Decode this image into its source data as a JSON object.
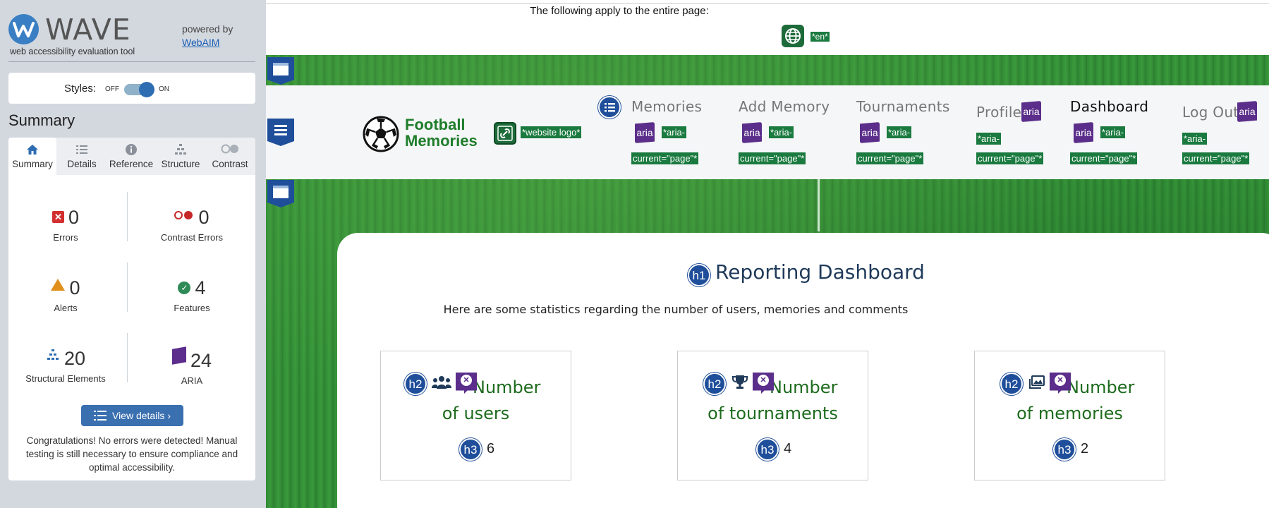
{
  "wave": {
    "title": "WAVE",
    "tagline": "web accessibility evaluation tool",
    "powered_by": "powered by",
    "webaim_link": "WebAIM",
    "styles_label": "Styles:",
    "styles_off": "OFF",
    "styles_on": "ON",
    "summary_heading": "Summary",
    "tabs": [
      {
        "label": "Summary",
        "icon": "home-icon"
      },
      {
        "label": "Details",
        "icon": "list-icon"
      },
      {
        "label": "Reference",
        "icon": "info-icon"
      },
      {
        "label": "Structure",
        "icon": "sitemap-icon"
      },
      {
        "label": "Contrast",
        "icon": "contrast-icon"
      }
    ],
    "stats": {
      "errors": {
        "value": "0",
        "label": "Errors"
      },
      "contrast_errors": {
        "value": "0",
        "label": "Contrast Errors"
      },
      "alerts": {
        "value": "0",
        "label": "Alerts"
      },
      "features": {
        "value": "4",
        "label": "Features"
      },
      "structural": {
        "value": "20",
        "label": "Structural Elements"
      },
      "aria": {
        "value": "24",
        "label": "ARIA"
      }
    },
    "view_details": "View details ›",
    "congrats": "Congratulations! No errors were detected! Manual testing is still necessary to ensure compliance and optimal accessibility."
  },
  "page": {
    "entire_page_note": "The following apply to the entire page:",
    "lang_tag": "*en*",
    "site_name_line1": "Football",
    "site_name_line2": "Memories",
    "logo_tag": "*website logo*",
    "aria_label": "aria",
    "aria_current_line1": "*aria-",
    "aria_current_line2": "current=\"page\"*",
    "nav": [
      {
        "label": "Memories"
      },
      {
        "label": "Add Memory"
      },
      {
        "label": "Tournaments"
      },
      {
        "label": "Profile"
      },
      {
        "label": "Dashboard"
      },
      {
        "label": "Log Out"
      }
    ],
    "dashboard_title": "Reporting Dashboard",
    "dashboard_subtitle": "Here are some statistics regarding the number of users, memories and comments",
    "h1": "h1",
    "h2": "h2",
    "h3": "h3",
    "cards": [
      {
        "title_line1": "Number",
        "title_line2": "of users",
        "value": "6",
        "icon": "users-icon"
      },
      {
        "title_line1": "Number",
        "title_line2": "of tournaments",
        "value": "4",
        "icon": "trophy-icon"
      },
      {
        "title_line1": "Number",
        "title_line2": "of memories",
        "value": "2",
        "icon": "images-icon"
      }
    ]
  },
  "colors": {
    "wave_blue": "#2f6db2",
    "aria_purple": "#5a2e8a",
    "feature_green": "#1a7a3f",
    "heading_green": "#1e6b1e",
    "grass": "#2f8a34"
  }
}
